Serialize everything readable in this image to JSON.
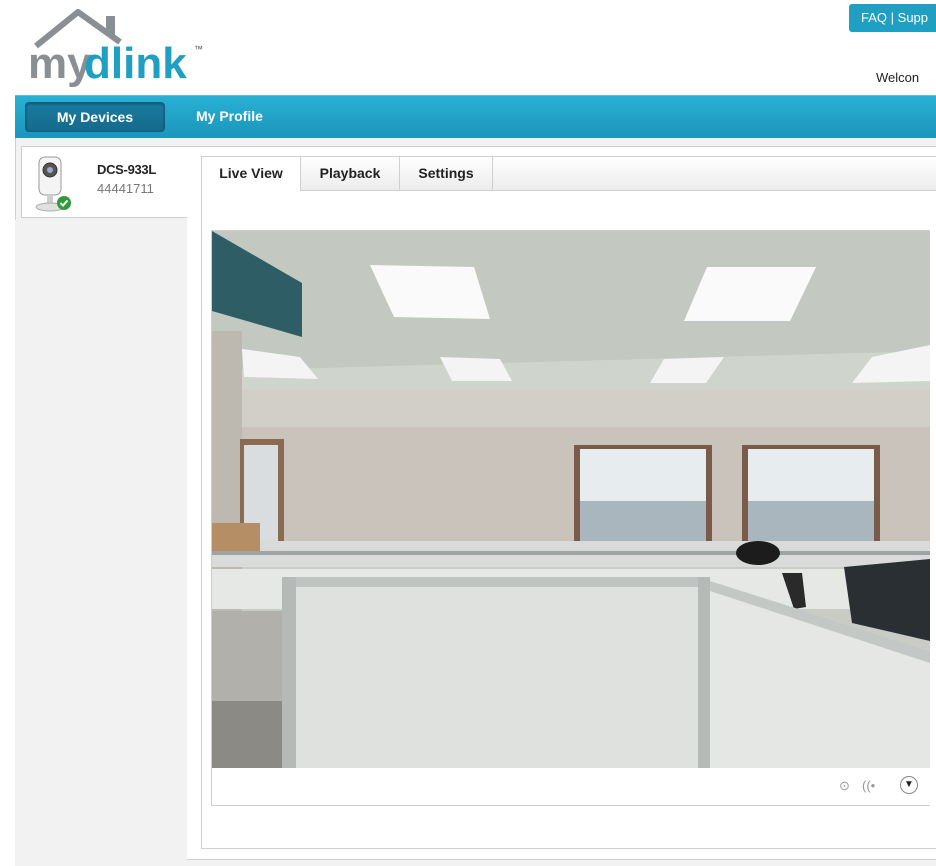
{
  "brand": {
    "logo_text": "mydlink",
    "trademark": "™"
  },
  "header": {
    "faq": "FAQ",
    "separator": "|",
    "support": "Supp",
    "welcome": "Welcon"
  },
  "nav": {
    "my_devices": "My Devices",
    "my_profile": "My Profile"
  },
  "device": {
    "name": "DCS-933L",
    "id": "44441711",
    "status_icon": "check-icon",
    "status_color": "#2e9b3a"
  },
  "tabs": [
    {
      "label": "Live View",
      "active": true
    },
    {
      "label": "Playback",
      "active": false
    },
    {
      "label": "Settings",
      "active": false
    }
  ],
  "player": {
    "feed": "office-camera-feed",
    "controls": {
      "record": "⊙",
      "audio": "((•",
      "menu": "▼"
    }
  },
  "colors": {
    "accent": "#1fa0c3",
    "nav_active": "#146a8c",
    "logo_gray": "#8a8f94",
    "logo_blue": "#1fa0c3"
  }
}
